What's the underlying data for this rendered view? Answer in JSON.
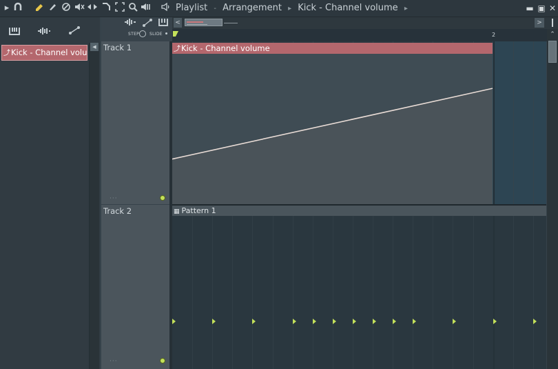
{
  "toolbar": {
    "icons": [
      "play-arrow-icon",
      "magnet-icon",
      "pencil-icon",
      "paint-brush-icon",
      "delete-icon",
      "mute-icon",
      "slip-icon",
      "slice-icon",
      "select-icon",
      "zoom-icon",
      "playback-icon",
      "speaker-icon"
    ],
    "title_parts": [
      "Playlist",
      "Arrangement",
      "Kick - Channel volume"
    ]
  },
  "left_panel": {
    "icons": [
      "piano-roll-icon",
      "waveform-icon",
      "automation-icon"
    ],
    "clip_label": "Kick - Channel volume"
  },
  "tool_strip": {
    "step_label": "STEP",
    "slide_label": "SLIDE"
  },
  "ruler": {
    "bar_number": "2"
  },
  "tracks": [
    {
      "name": "Track 1",
      "clip_label": "Kick - Channel volume"
    },
    {
      "name": "Track 2",
      "clip_label": "Pattern 1"
    }
  ],
  "automation": {
    "color": "#b4676d",
    "start_level": 0.3,
    "end_level": 0.77
  },
  "pattern_notes_count": 10,
  "colors": {
    "accent_green": "#c3e05a",
    "clip_red": "#b4676d"
  }
}
